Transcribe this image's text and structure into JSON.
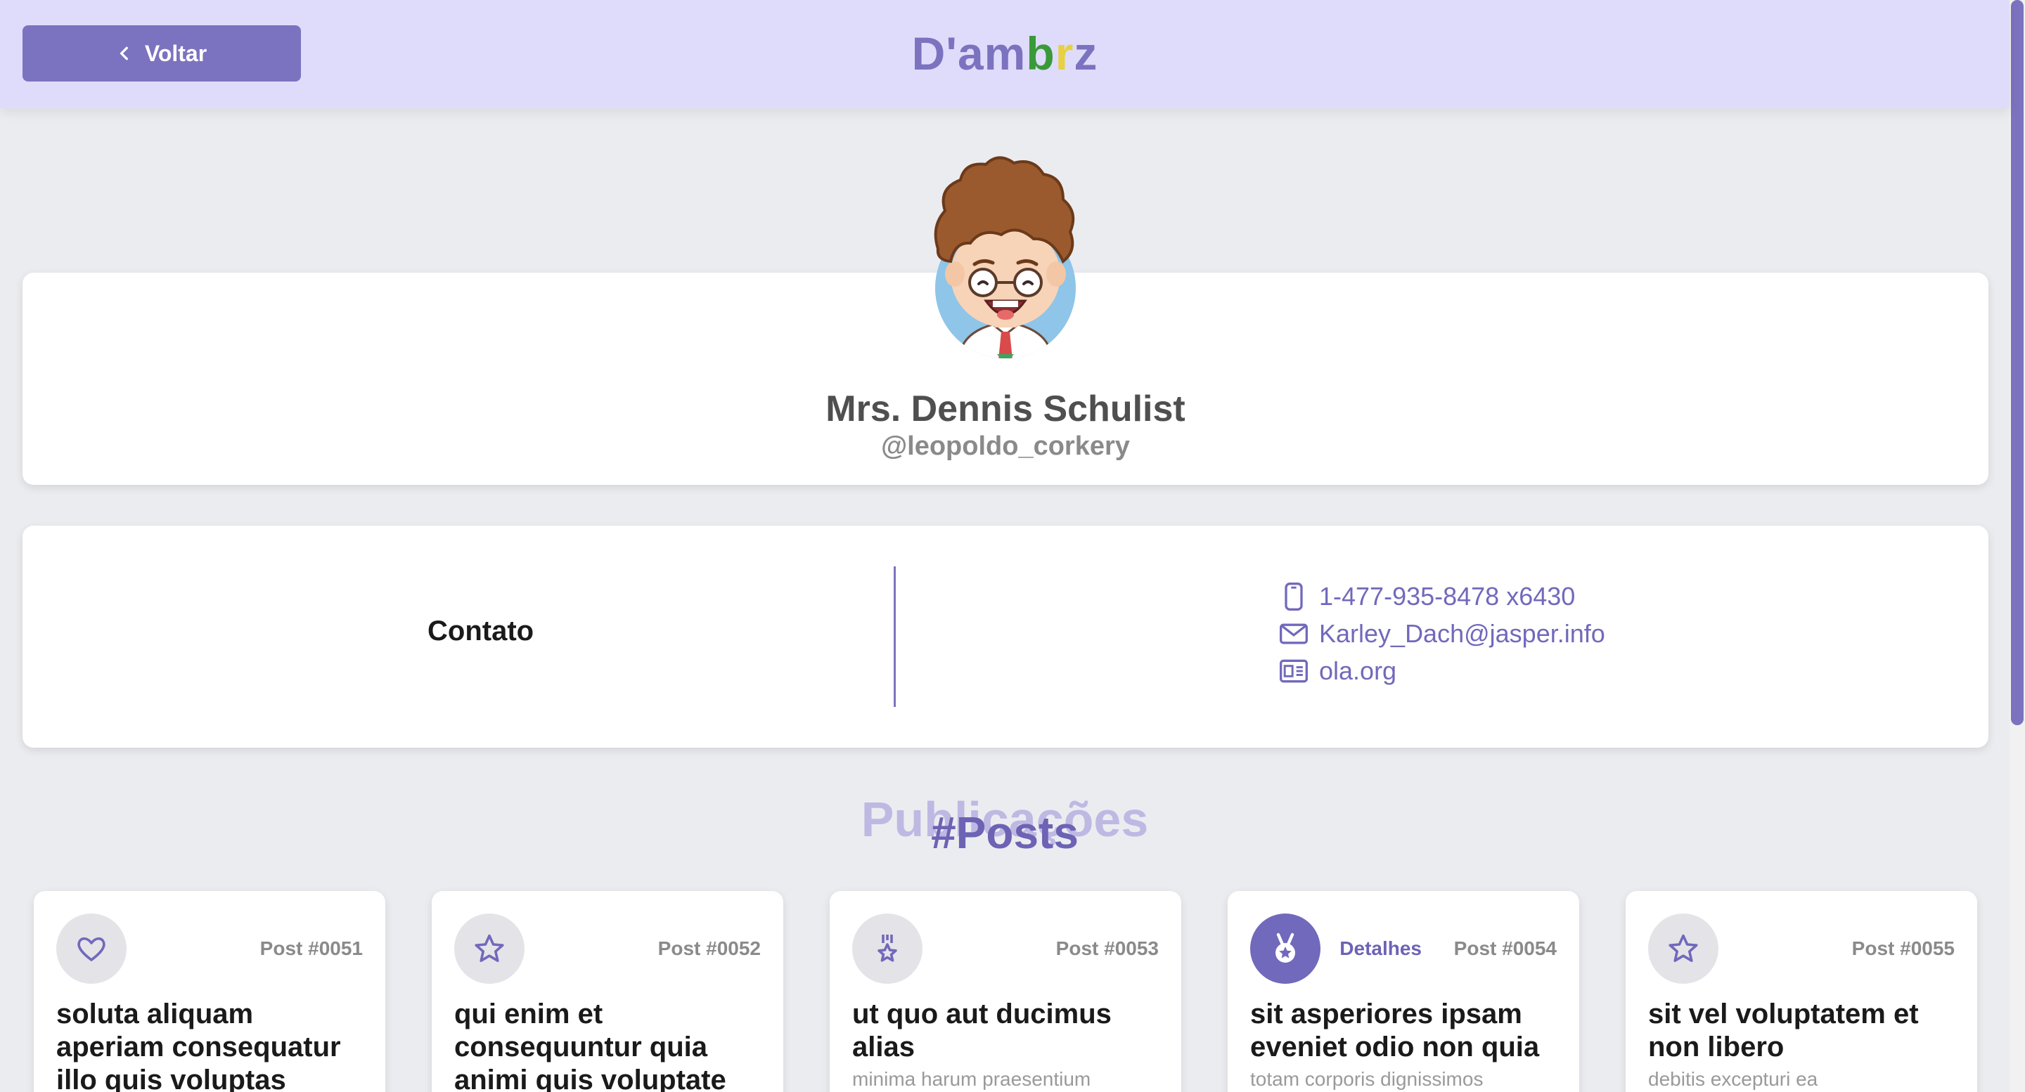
{
  "header": {
    "back_label": "Voltar",
    "brand": {
      "part1": "D'am",
      "part2": "b",
      "part3": "r",
      "part4": "z"
    }
  },
  "colors": {
    "accent": "#7b73bf",
    "header_bg": "#dfdcfb",
    "brand_b": "#3a9a3a",
    "brand_r": "#e7d140"
  },
  "profile": {
    "name": "Mrs. Dennis Schulist",
    "handle": "@leopoldo_corkery"
  },
  "contact": {
    "title": "Contato",
    "phone": "1-477-935-8478 x6430",
    "email": "Karley_Dach@jasper.info",
    "website": "ola.org"
  },
  "section": {
    "title_bg": "Publicações",
    "title_fg": "#Posts"
  },
  "posts": [
    {
      "number": "Post #0051",
      "icon": "heart-icon",
      "title": "soluta aliquam aperiam consequatur illo quis voluptas",
      "body": ""
    },
    {
      "number": "Post #0052",
      "icon": "star-icon",
      "title": "qui enim et consequuntur quia animi quis voluptate",
      "body": ""
    },
    {
      "number": "Post #0053",
      "icon": "medal-icon",
      "title": "ut quo aut ducimus alias",
      "body": "minima harum praesentium"
    },
    {
      "number": "Post #0054",
      "icon": "medal-badge-icon",
      "details": "Detalhes",
      "title": "sit asperiores ipsam eveniet odio non quia",
      "body": "totam corporis dignissimos"
    },
    {
      "number": "Post #0055",
      "icon": "star-icon",
      "title": "sit vel voluptatem et non libero",
      "body": "debitis excepturi ea"
    }
  ]
}
